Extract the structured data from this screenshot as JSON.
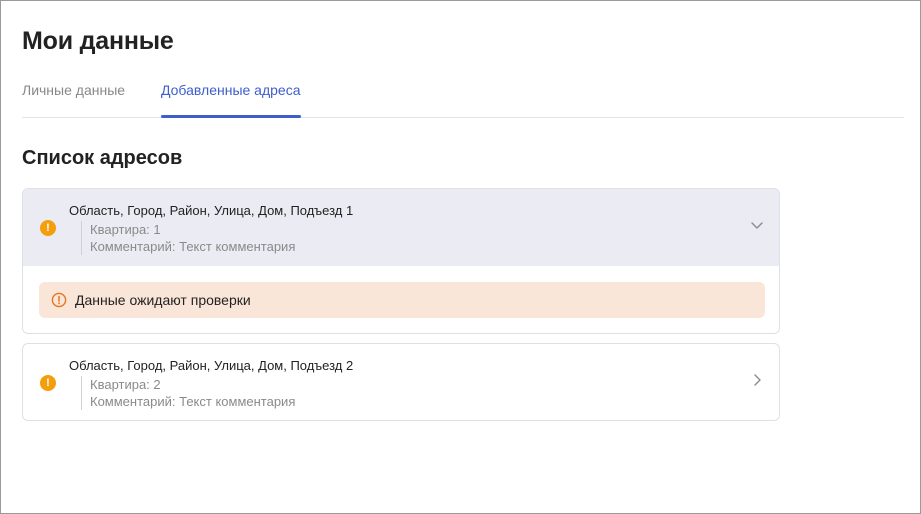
{
  "page": {
    "title": "Мои данные"
  },
  "tabs": [
    {
      "label": "Личные данные",
      "active": false
    },
    {
      "label": "Добавленные адреса",
      "active": true
    }
  ],
  "section": {
    "title": "Список адресов"
  },
  "addresses": [
    {
      "address": "Область, Город, Район, Улица, Дом, Подъезд 1",
      "apartment": "Квартира: 1",
      "comment": "Комментарий: Текст комментария",
      "expanded": true,
      "status_icon": "warning-icon",
      "notice": "Данные ожидают проверки"
    },
    {
      "address": "Область, Город, Район, Улица, Дом, Подъезд 2",
      "apartment": "Квартира: 2",
      "comment": "Комментарий: Текст комментария",
      "expanded": false,
      "status_icon": "warning-icon"
    }
  ],
  "colors": {
    "accent": "#3d5ecc",
    "warning": "#f59e0b",
    "notice_bg": "#f9e6d8",
    "expanded_header_bg": "#ebebf3"
  }
}
